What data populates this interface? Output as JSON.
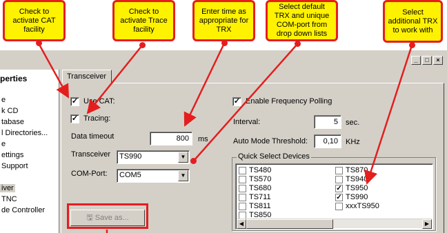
{
  "callouts": {
    "cat": "Check to activate CAT facility",
    "trace": "Check to activate Trace facility",
    "time": "Enter time as appropriate for TRX",
    "default_trx": "Select default TRX and unique COM-port from drop down lists",
    "additional_trx": "Select additional TRX to work with"
  },
  "window": {
    "minimize": "_",
    "maximize": "□",
    "close": "×"
  },
  "tree": {
    "header": "perties",
    "items": [
      "e",
      "k CD",
      "tabase",
      "l Directories...",
      "e",
      "ettings",
      "Support",
      "iver",
      "TNC",
      "de Controller"
    ]
  },
  "tab": {
    "label": "Transceiver"
  },
  "settings": {
    "use_cat_label": "Use CAT:",
    "use_cat_checked": true,
    "tracing_label": "Tracing:",
    "tracing_checked": true,
    "data_timeout_label": "Data timeout",
    "data_timeout_value": "800",
    "data_timeout_unit": "ms",
    "transceiver_label": "Transceiver",
    "transceiver_value": "TS990",
    "com_port_label": "COM-Port:",
    "com_port_value": "COM5",
    "save_button": "Save as...",
    "enable_polling_label": "Enable Frequency Polling",
    "enable_polling_checked": true,
    "interval_label": "Interval:",
    "interval_value": "5",
    "interval_unit": "sec.",
    "auto_mode_label": "Auto Mode Threshold:",
    "auto_mode_value": "0,10",
    "auto_mode_unit": "KHz"
  },
  "quick_select": {
    "title": "Quick Select Devices",
    "col1": [
      {
        "label": "TS480",
        "checked": false
      },
      {
        "label": "TS570",
        "checked": false
      },
      {
        "label": "TS680",
        "checked": false
      },
      {
        "label": "TS711",
        "checked": false
      },
      {
        "label": "TS811",
        "checked": false
      },
      {
        "label": "TS850",
        "checked": false
      }
    ],
    "col2": [
      {
        "label": "TS870",
        "checked": false
      },
      {
        "label": "TS940",
        "checked": false
      },
      {
        "label": "TS950",
        "checked": true
      },
      {
        "label": "TS990",
        "checked": true
      },
      {
        "label": "xxxTS950",
        "checked": false
      }
    ]
  },
  "colors": {
    "callout_fill": "#fff200",
    "callout_border": "#e41e1e",
    "dialog_bg": "#d4d0c8"
  }
}
